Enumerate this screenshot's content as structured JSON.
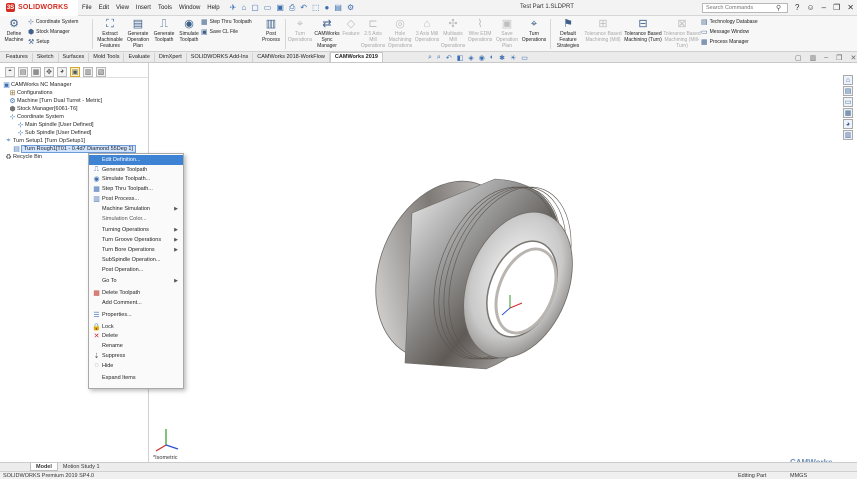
{
  "app": {
    "brand": "SOLIDWORKS",
    "menus": [
      "File",
      "Edit",
      "View",
      "Insert",
      "Tools",
      "Window",
      "Help"
    ],
    "document_title": "Test Part 1.SLDPRT",
    "search_placeholder": "Search Commands"
  },
  "ribbon": {
    "coordinate_system": "Coordinate System",
    "stock_manager": "Stock Manager",
    "setup": "Setup",
    "define_machine": "Define Machine",
    "extract_features": "Extract Machinable Features",
    "generate_operation_plan": "Generate Operation Plan",
    "generate_toolpath": "Generate Toolpath",
    "simulate_toolpath": "Simulate Toolpath",
    "step_thru_toolpath": "Step Thru Toolpath",
    "save_cl_file": "Save CL File",
    "post_process": "Post Process",
    "turn_operations": "Turn Operations",
    "camworks_sync_manager": "CAMWorks Sync Manager",
    "feature": "Feature",
    "axis_mill_ops": "2.5 Axis Mill Operations",
    "hole_machining_ops": "Hole Machining Operations",
    "axis3_mill_ops": "3 Axis Mill Operations",
    "multiaxis_mill_ops": "Multiaxis Mill Operations",
    "wire_edm_ops": "Wire EDM Operations",
    "save_operation_plan": "Save Operation Plan",
    "turn_operations_2": "Turn Operations",
    "default_feature_strategies": "Default Feature Strategies",
    "tolerance_mill": "Tolerance Based Machining (Mill)",
    "tolerance_turn": "Tolerance Based Machining (Turn)",
    "tolerance_millturn": "Tolerance Based Machining (Mill-Turn)",
    "technology_database": "Technology Database",
    "message_window": "Message Window",
    "process_manager": "Process Manager"
  },
  "tabs": [
    "Features",
    "Sketch",
    "Surfaces",
    "Mold Tools",
    "Evaluate",
    "DimXpert",
    "SOLIDWORKS Add-Ins",
    "CAMWorks 2018-WorkFlow",
    "CAMWorks 2019"
  ],
  "active_tab_index": 8,
  "tree": {
    "root": "CAMWorks NC Manager",
    "configurations": "Configurations",
    "machine": "Machine [Turn Dual Turret - Metric]",
    "stock_manager": "Stock Manager[6061-T6]",
    "coordinate_system": "Coordinate System",
    "main_spindle": "Main Spindle [User Defined]",
    "sub_spindle": "Sub Spindle [User Defined]",
    "turn_setup": "Turn Setup1 [Turn OpSetup1]",
    "turn_rough": "Turn Rough1[T01 - 0.4d7 Diamond 55Deg 1]",
    "recycle_bin": "Recycle Bin"
  },
  "context_menu": [
    {
      "label": "Edit Definition...",
      "icon": "edit-icon"
    },
    {
      "label": "Generate Toolpath",
      "icon": "generate-icon"
    },
    {
      "label": "Simulate Toolpath...",
      "icon": "simulate-icon"
    },
    {
      "label": "Step Thru Toolpath...",
      "icon": "step-icon"
    },
    {
      "label": "Post Process...",
      "icon": "post-icon"
    },
    {
      "label": "Machine Simulation",
      "icon": ""
    },
    {
      "label": "Simulation Color...",
      "icon": ""
    },
    {
      "label": "Turning Operations",
      "icon": ""
    },
    {
      "label": "Turn Groove Operations",
      "icon": ""
    },
    {
      "label": "Turn Bore Operations",
      "icon": ""
    },
    {
      "label": "SubSpindle Operation...",
      "icon": ""
    },
    {
      "label": "Post Operation...",
      "icon": ""
    },
    {
      "label": "Go To",
      "icon": ""
    },
    {
      "label": "Delete Toolpath",
      "icon": "delete-toolpath-icon"
    },
    {
      "label": "Add Comment...",
      "icon": ""
    },
    {
      "label": "Properties...",
      "icon": "properties-icon"
    },
    {
      "label": "Lock",
      "icon": "lock-icon"
    },
    {
      "label": "Delete",
      "icon": "delete-icon"
    },
    {
      "label": "Rename",
      "icon": ""
    },
    {
      "label": "Suppress",
      "icon": "suppress-icon"
    },
    {
      "label": "Hide",
      "icon": "hide-icon"
    },
    {
      "label": "Expand Items",
      "icon": ""
    }
  ],
  "viewport": {
    "view_name": "*Isometric",
    "watermark": "CAMWorks"
  },
  "model_tabs": [
    "Model",
    "Motion Study 1"
  ],
  "status": {
    "left": "SOLIDWORKS Premium 2019 SP4.0",
    "editing": "Editing Part",
    "units": "MMGS"
  }
}
